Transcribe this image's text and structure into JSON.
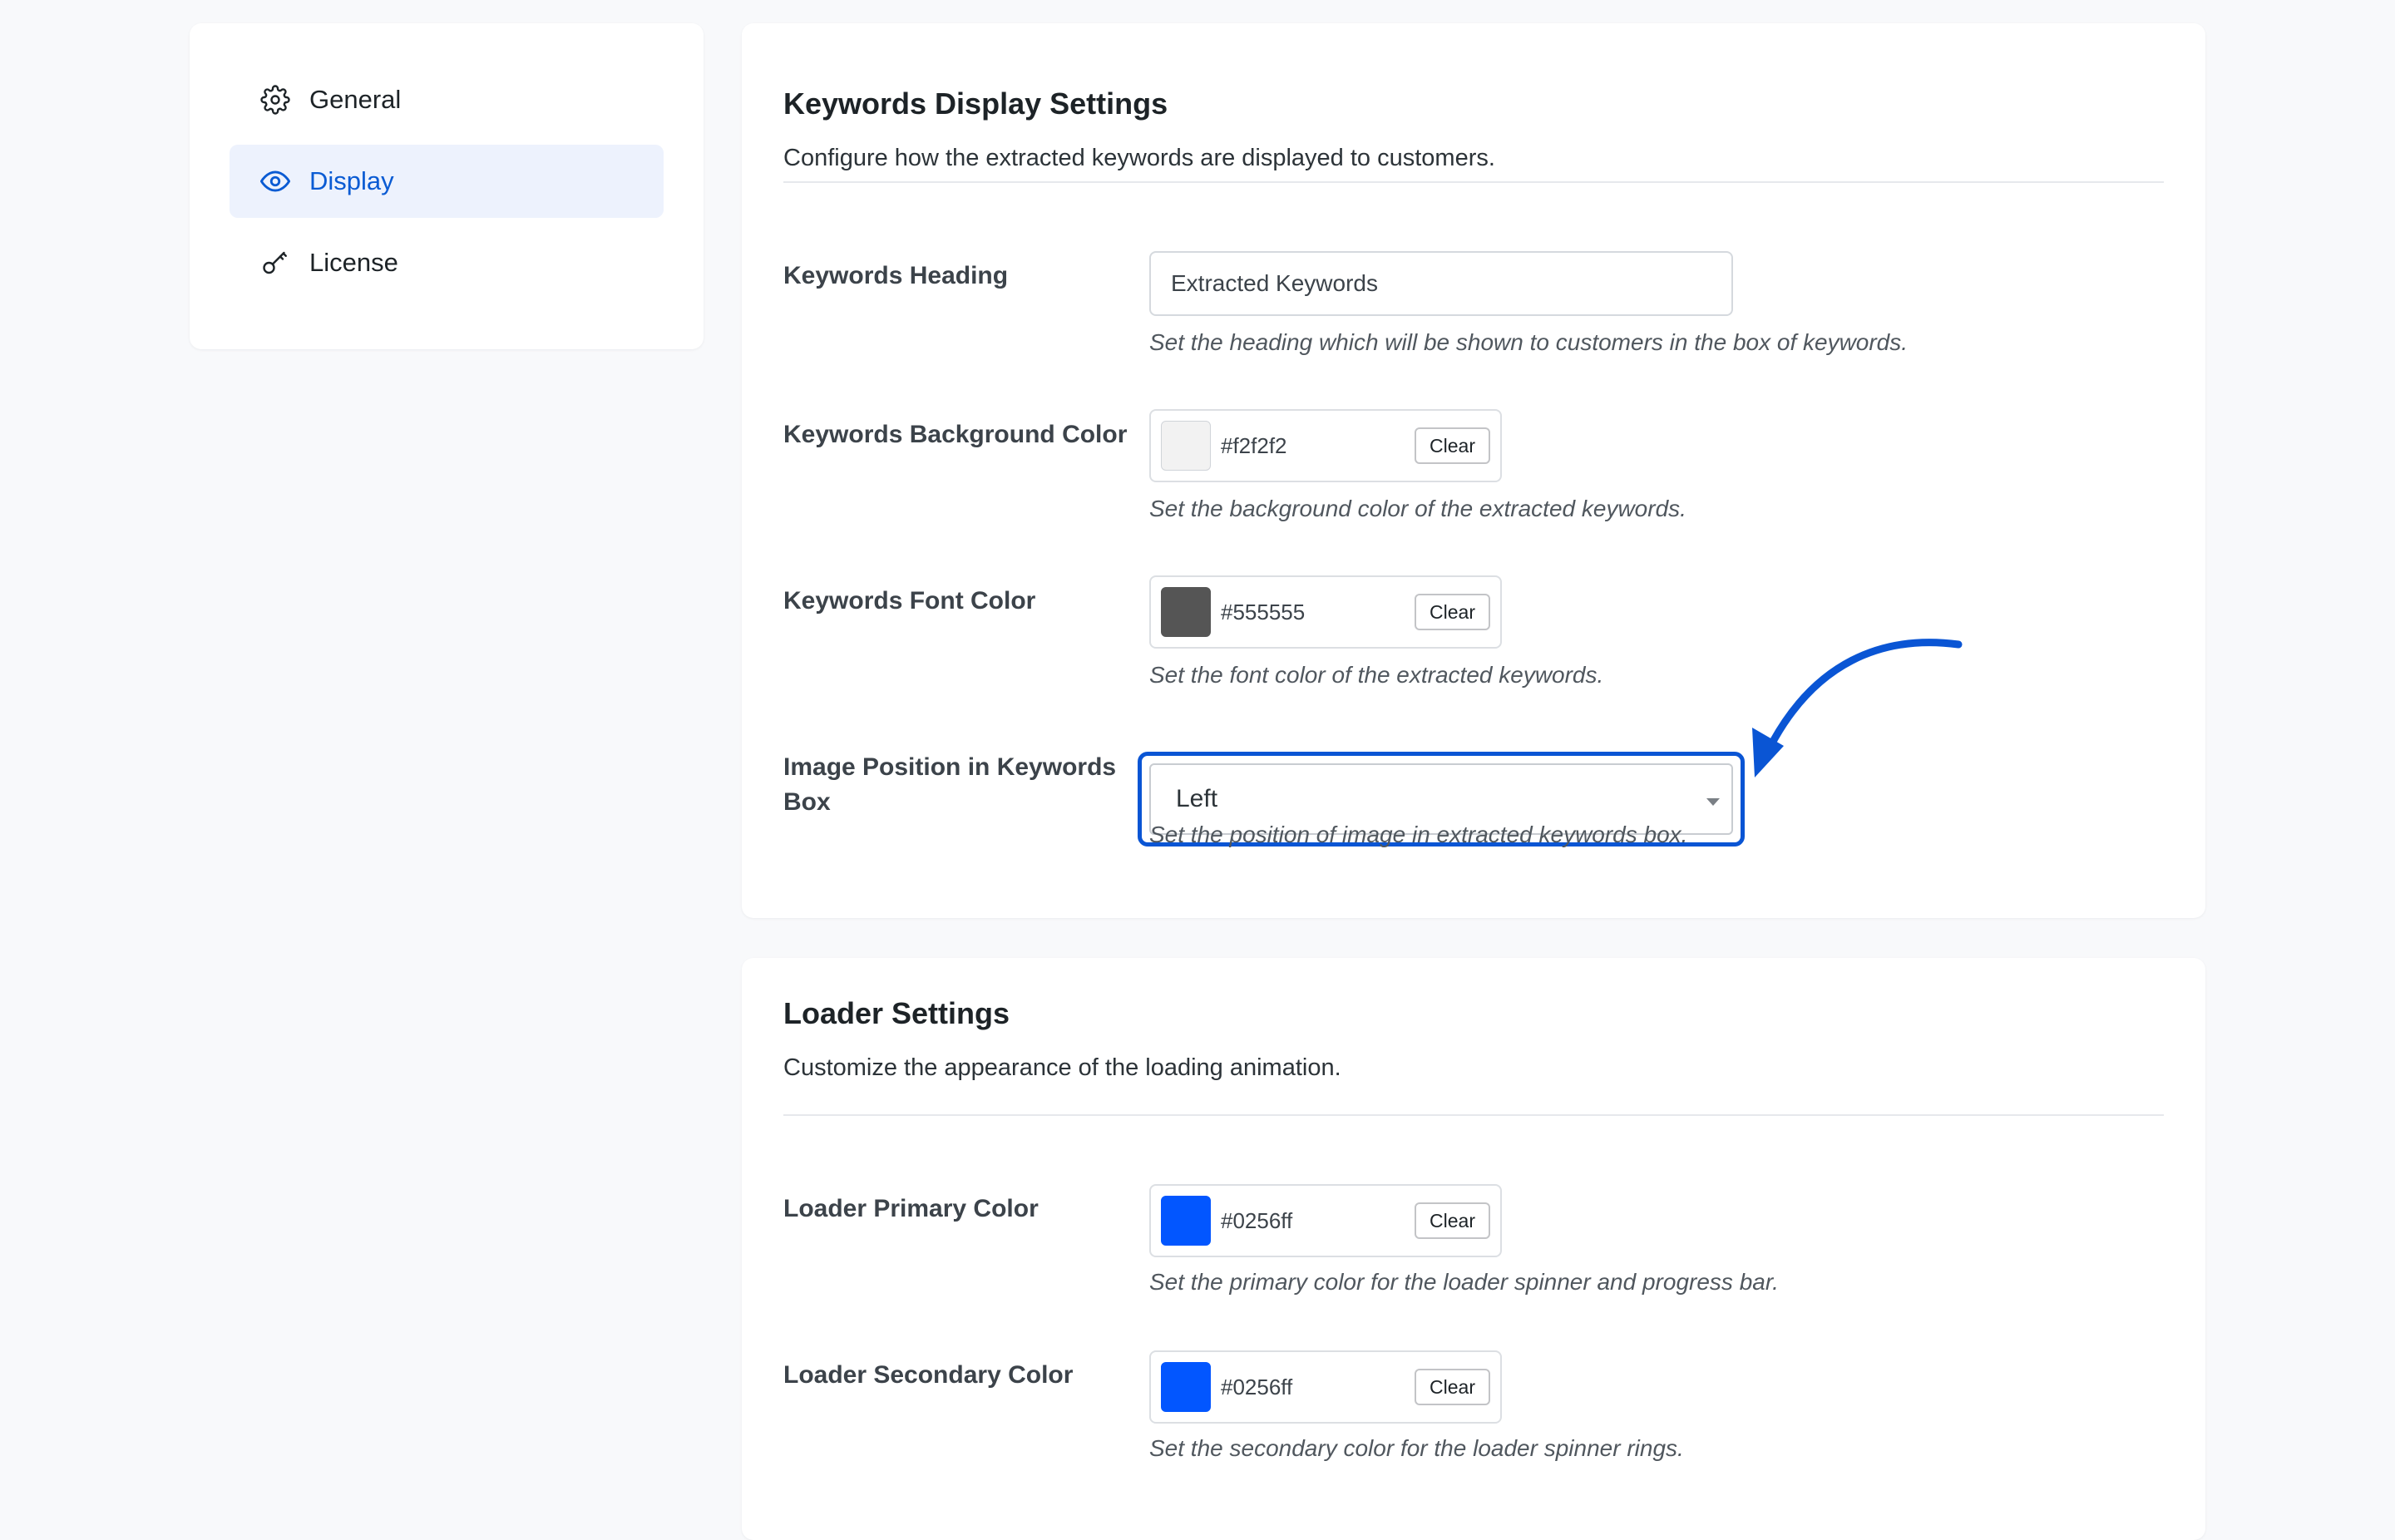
{
  "sidebar": {
    "items": [
      {
        "label": "General",
        "icon": "gear-icon",
        "active": false
      },
      {
        "label": "Display",
        "icon": "eye-icon",
        "active": true
      },
      {
        "label": "License",
        "icon": "key-icon",
        "active": false
      }
    ]
  },
  "keywords_display": {
    "title": "Keywords Display Settings",
    "description": "Configure how the extracted keywords are displayed to customers.",
    "heading": {
      "label": "Keywords Heading",
      "value": "Extracted Keywords",
      "help": "Set the heading which will be shown to customers in the box of keywords."
    },
    "background_color": {
      "label": "Keywords Background Color",
      "value": "#f2f2f2",
      "clear_label": "Clear",
      "help": "Set the background color of the extracted keywords."
    },
    "font_color": {
      "label": "Keywords Font Color",
      "value": "#555555",
      "clear_label": "Clear",
      "help": "Set the font color of the extracted keywords."
    },
    "image_position": {
      "label": "Image Position in Keywords Box",
      "value": "Left",
      "help": "Set the position of image in extracted keywords box."
    }
  },
  "loader": {
    "title": "Loader Settings",
    "description": "Customize the appearance of the loading animation.",
    "primary_color": {
      "label": "Loader Primary Color",
      "value": "#0256ff",
      "clear_label": "Clear",
      "help": "Set the primary color for the loader spinner and progress bar."
    },
    "secondary_color": {
      "label": "Loader Secondary Color",
      "value": "#0256ff",
      "clear_label": "Clear",
      "help": "Set the secondary color for the loader spinner rings."
    }
  },
  "colors": {
    "accent": "#0a5bd3",
    "highlight": "#0a55d4",
    "active_nav_bg": "#edf2fd"
  }
}
